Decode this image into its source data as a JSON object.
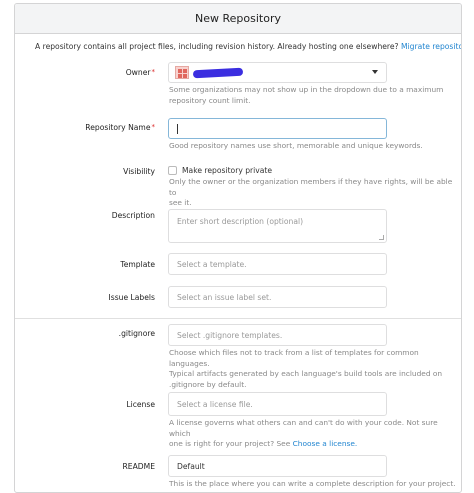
{
  "header": {
    "title": "New Repository"
  },
  "intro": {
    "text": "A repository contains all project files, including revision history. Already hosting one elsewhere?",
    "link": "Migrate repository."
  },
  "owner": {
    "label": "Owner",
    "required_mark": "*",
    "help_1": "Some organizations may not show up in the dropdown due to a maximum",
    "help_2": "repository count limit."
  },
  "repo_name": {
    "label": "Repository Name",
    "required_mark": "*",
    "value": "",
    "help": "Good repository names use short, memorable and unique keywords."
  },
  "visibility": {
    "label": "Visibility",
    "checkbox_label": "Make repository private",
    "checked": false,
    "help_1": "Only the owner or the organization members if they have rights, will be able to",
    "help_2": "see it."
  },
  "description": {
    "label": "Description",
    "placeholder": "Enter short description (optional)"
  },
  "template": {
    "label": "Template",
    "placeholder": "Select a template."
  },
  "issue_labels": {
    "label": "Issue Labels",
    "placeholder": "Select an issue label set."
  },
  "gitignore": {
    "label": ".gitignore",
    "placeholder": "Select .gitignore templates.",
    "help_1": "Choose which files not to track from a list of templates for common languages.",
    "help_2": "Typical artifacts generated by each language's build tools are included on",
    "help_3": ".gitignore by default."
  },
  "license": {
    "label": "License",
    "placeholder": "Select a license file.",
    "help_1": "A license governs what others can and can't do with your code. Not sure which",
    "help_2": "one is right for your project? See",
    "help_link": "Choose a license."
  },
  "readme": {
    "label": "README",
    "value": "Default",
    "help": "This is the place where you can write a complete description for your project."
  },
  "colors": {
    "link": "#2185d0",
    "required": "#db2828",
    "focus_border": "#85b7d9",
    "header_bg": "#f3f4f5"
  }
}
